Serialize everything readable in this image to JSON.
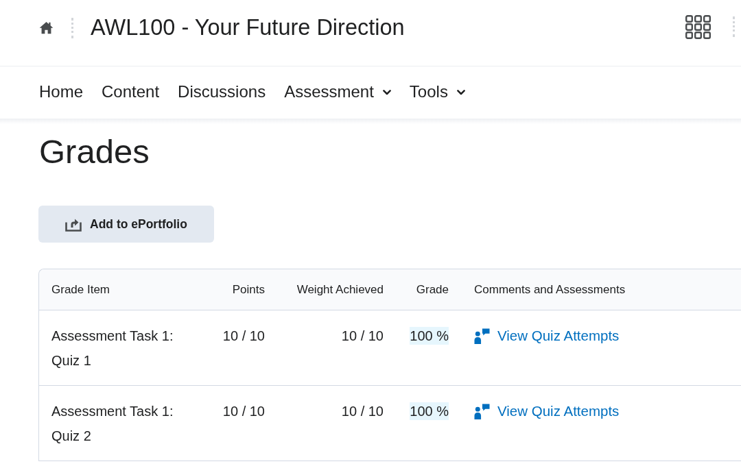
{
  "header": {
    "title": "AWL100 - Your Future Direction"
  },
  "nav": [
    {
      "label": "Home",
      "has_menu": false
    },
    {
      "label": "Content",
      "has_menu": false
    },
    {
      "label": "Discussions",
      "has_menu": false
    },
    {
      "label": "Assessment",
      "has_menu": true
    },
    {
      "label": "Tools",
      "has_menu": true
    }
  ],
  "page_title": "Grades",
  "action_button": {
    "label": "Add to ePortfolio"
  },
  "table": {
    "columns": [
      "Grade Item",
      "Points",
      "Weight Achieved",
      "Grade",
      "Comments and Assessments"
    ],
    "rows": [
      {
        "grade_item": "Assessment Task 1: Quiz 1",
        "points": "10 / 10",
        "weight_achieved": "10 / 10",
        "grade": "100 %",
        "comments_link": "View Quiz Attempts"
      },
      {
        "grade_item": "Assessment Task 1: Quiz 2",
        "points": "10 / 10",
        "weight_achieved": "10 / 10",
        "grade": "100 %",
        "comments_link": "View Quiz Attempts"
      }
    ]
  }
}
